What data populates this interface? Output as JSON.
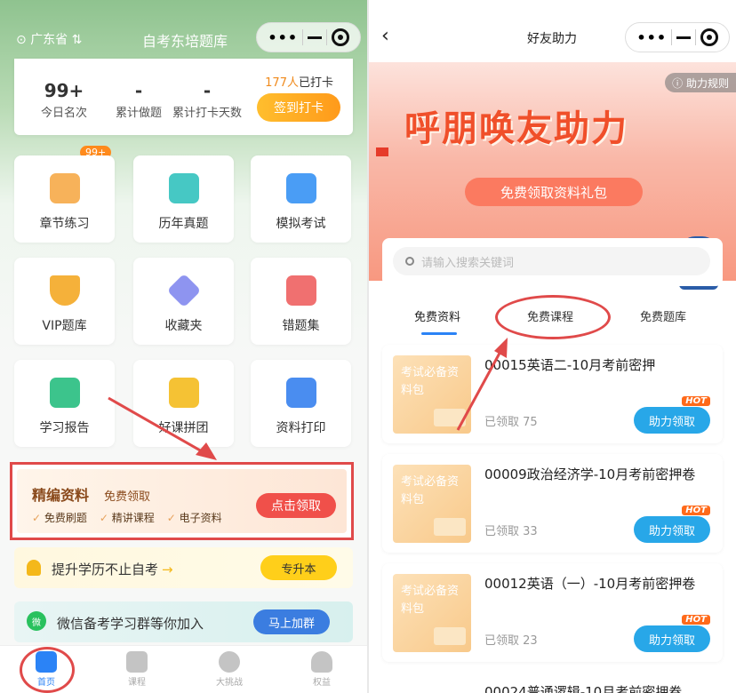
{
  "left": {
    "location": "广东省",
    "title": "自考东培题库",
    "stats": [
      {
        "value": "99+",
        "label": "今日名次"
      },
      {
        "value": "-",
        "label": "累计做题"
      },
      {
        "value": "-",
        "label": "累计打卡天数"
      }
    ],
    "checkin_count": "177人",
    "checkin_suffix": "已打卡",
    "checkin_button": "签到打卡",
    "badge": "99+",
    "tiles": [
      {
        "label": "章节练习",
        "icon": "book-icon",
        "color": "#f7b25a"
      },
      {
        "label": "历年真题",
        "icon": "paper-icon",
        "color": "#46c8c4"
      },
      {
        "label": "模拟考试",
        "icon": "exam-icon",
        "color": "#4a9df5"
      },
      {
        "label": "VIP题库",
        "icon": "vip-icon",
        "color": "#f5b13a"
      },
      {
        "label": "收藏夹",
        "icon": "star-icon",
        "color": "#8e94f0"
      },
      {
        "label": "错题集",
        "icon": "wrong-icon",
        "color": "#f07070"
      },
      {
        "label": "学习报告",
        "icon": "report-icon",
        "color": "#3cc48c"
      },
      {
        "label": "好课拼团",
        "icon": "group-icon",
        "color": "#f5c234"
      },
      {
        "label": "资料打印",
        "icon": "printer-icon",
        "color": "#4a8df0"
      }
    ],
    "promo": {
      "title": "精编资料",
      "subtitle": "免费领取",
      "tags": [
        "免费刷题",
        "精讲课程",
        "电子资料"
      ],
      "button": "点击领取"
    },
    "edu": {
      "text": "提升学历不止自考",
      "arrow": "→",
      "button": "专升本"
    },
    "wechat": {
      "text": "微信备考学习群等你加入",
      "button": "马上加群",
      "icon_text": "微"
    },
    "tabbar": [
      {
        "label": "首页",
        "icon": "home-icon"
      },
      {
        "label": "课程",
        "icon": "course-icon"
      },
      {
        "label": "大挑战",
        "icon": "challenge-icon"
      },
      {
        "label": "权益",
        "icon": "profile-icon"
      }
    ]
  },
  "right": {
    "title": "好友助力",
    "back": "‹",
    "rules": "ⓘ 助力规则",
    "banner_title": "呼朋唤友助力",
    "banner_sub": "免费领取资料礼包",
    "search_placeholder": "请输入搜索关键词",
    "tabs": [
      "免费资料",
      "免费课程",
      "免费题库"
    ],
    "thumb_label": "考试必备资料包",
    "hot": "HOT",
    "claim_button": "助力领取",
    "items": [
      {
        "title": "00015英语二-10月考前密押",
        "claimed": "已领取 75"
      },
      {
        "title": "00009政治经济学-10月考前密押卷",
        "claimed": "已领取 33"
      },
      {
        "title": "00012英语（一）-10月考前密押卷",
        "claimed": "已领取 23"
      }
    ],
    "last_item": "00024普通逻辑-10月考前密押卷"
  },
  "colors": {
    "accent": "#2b83f6",
    "highlight": "#e04a4a",
    "orange": "#ff9a1a"
  }
}
